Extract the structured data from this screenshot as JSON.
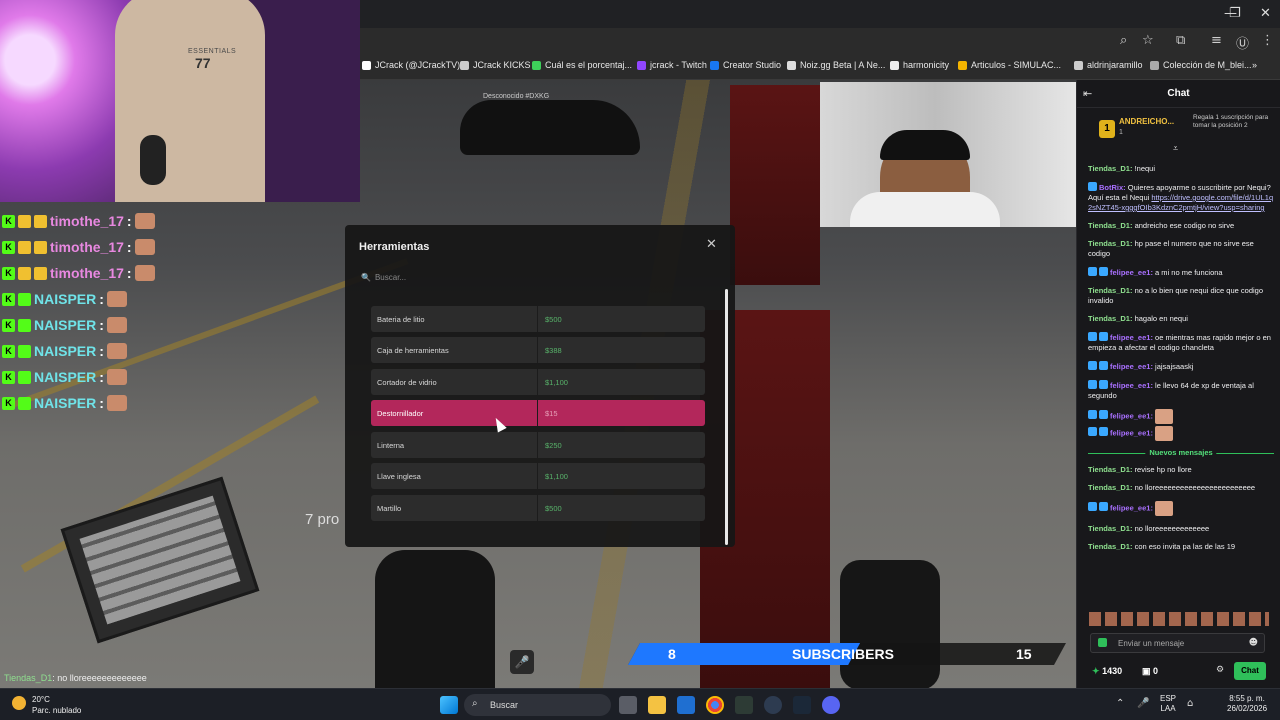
{
  "window": {
    "minimize": "—",
    "maximize": "❐",
    "close": "✕"
  },
  "bookmarks": [
    {
      "label": "JCrack (@JCrackTV)...",
      "color": "#ffffff"
    },
    {
      "label": "JCrack KICKS",
      "color": "#cccccc"
    },
    {
      "label": "Cuál es el porcentaj...",
      "color": "#3ecf5a"
    },
    {
      "label": "jcrack - Twitch",
      "color": "#9146ff"
    },
    {
      "label": "Creator Studio",
      "color": "#1877f2"
    },
    {
      "label": "Noiz.gg Beta | A Ne...",
      "color": "#dddddd"
    },
    {
      "label": "harmonicity",
      "color": "#eeeeee"
    },
    {
      "label": "Articulos - SIMULAC...",
      "color": "#f4b400"
    },
    {
      "label": "aldrinjaramillo",
      "color": "#cccccc"
    },
    {
      "label": "Colección de M_blei...",
      "color": "#aaaaaa"
    }
  ],
  "game": {
    "garage_label": "Desconocido #DXKG",
    "hint_text": "7 pro",
    "panel": {
      "title": "Herramientas",
      "close": "✕",
      "search_placeholder": "Buscar...",
      "items": [
        {
          "name": "Bateria de litio",
          "price": "$500"
        },
        {
          "name": "Caja de herramientas",
          "price": "$388"
        },
        {
          "name": "Cortador de vidrio",
          "price": "$1,100"
        },
        {
          "name": "Destornillador",
          "price": "$15"
        },
        {
          "name": "Linterna",
          "price": "$250"
        },
        {
          "name": "Llave inglesa",
          "price": "$1,100"
        },
        {
          "name": "Martillo",
          "price": "$500"
        }
      ]
    }
  },
  "overlay_chat": [
    {
      "name": "timothe_17",
      "color": "#e888e0"
    },
    {
      "name": "timothe_17",
      "color": "#e888e0"
    },
    {
      "name": "timothe_17",
      "color": "#e888e0"
    },
    {
      "name": "NAISPER",
      "color": "#6fe3e8"
    },
    {
      "name": "NAISPER",
      "color": "#6fe3e8"
    },
    {
      "name": "NAISPER",
      "color": "#6fe3e8"
    },
    {
      "name": "NAISPER",
      "color": "#6fe3e8"
    },
    {
      "name": "NAISPER",
      "color": "#6fe3e8"
    }
  ],
  "overlay_bottom": {
    "user": "Tiendas_D1",
    "text": ": no lloreeeeeeeeeeeee"
  },
  "webcam": {
    "shirt_text": "ESSENTIALS",
    "shirt_number": "77"
  },
  "subscribers": {
    "current": "8",
    "label": "SUBSCRIBERS",
    "goal": "15",
    "progress": 0.53
  },
  "chat": {
    "title": "Chat",
    "pinned": {
      "user": "ANDREICHO...",
      "count": "1",
      "rank": "1",
      "reward": "Regala 1 suscripción para tomar la posición 2"
    },
    "m1": {
      "user": "Tiendas_D1:",
      "text": "!nequi"
    },
    "m2": {
      "user": "BotRix:",
      "text": "Quieres apoyarme o suscribirte por Nequi? Aquí esta el Nequi",
      "link": "https://drive.google.com/file/d/1UL1q2sNZT45-xgggfOIb3KdznC2pmtjH/view?usp=sharing"
    },
    "m3": {
      "user": "Tiendas_D1:",
      "text": "andreicho ese codigo no sirve"
    },
    "m4": {
      "user": "Tiendas_D1:",
      "text": "hp pase el numero que no sirve ese codigo"
    },
    "m5": {
      "user": "felipee_ee1:",
      "text": "a mi no me funciona"
    },
    "m6": {
      "user": "Tiendas_D1:",
      "text": "no a lo bien que nequi dice que codigo invalido"
    },
    "m7": {
      "user": "Tiendas_D1:",
      "text": "hagalo en nequi"
    },
    "m8": {
      "user": "felipee_ee1:",
      "text": "oe mientras mas rapido mejor o en empieza a afectar el codigo chancleta"
    },
    "m9": {
      "user": "felipee_ee1:",
      "text": "jajsajsaaskj"
    },
    "m10": {
      "user": "felipee_ee1:",
      "text": "le llevo 64 de xp de ventaja al segundo"
    },
    "m11": {
      "user": "felipee_ee1:",
      "text": ""
    },
    "m12": {
      "user": "felipee_ee1:",
      "text": ""
    },
    "new_messages": "Nuevos mensajes",
    "m13": {
      "user": "Tiendas_D1:",
      "text": "revise hp no llore"
    },
    "m14": {
      "user": "Tiendas_D1:",
      "text": "no lloreeeeeeeeeeeeeeeeeeeeeeee"
    },
    "m15": {
      "user": "felipee_ee1:",
      "text": ""
    },
    "m16": {
      "user": "Tiendas_D1:",
      "text": "no lloreeeeeeeeeeeee"
    },
    "m17": {
      "user": "Tiendas_D1:",
      "text": "con eso invita pa las de las 19"
    },
    "input_placeholder": "Enviar un mensaje",
    "points": "1430",
    "gifts": "0",
    "send_label": "Chat"
  },
  "taskbar": {
    "temperature": "20°C",
    "weather": "Parc. nublado",
    "search_placeholder": "Buscar",
    "lang_top": "ESP",
    "lang_bottom": "LAA",
    "time": "8:55 p. m.",
    "date": "26/02/2026"
  },
  "colors": {
    "accent_pink": "#b3275b",
    "kick_green": "#2fbf5a",
    "sub_blue": "#1e78ff"
  }
}
